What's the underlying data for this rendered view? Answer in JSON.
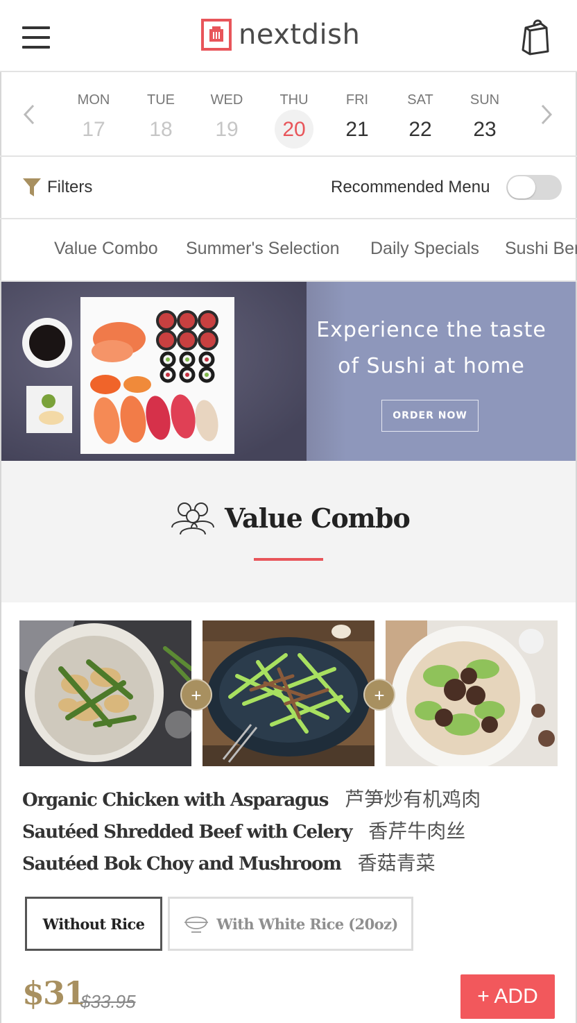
{
  "header": {
    "brand": "nextdish",
    "icons": {
      "menu": "hamburger-menu-icon",
      "logo": "nextdish-logo-icon",
      "cart": "shopping-bag-icon"
    }
  },
  "dates": {
    "days": [
      {
        "name": "MON",
        "num": "17",
        "state": "past"
      },
      {
        "name": "TUE",
        "num": "18",
        "state": "past"
      },
      {
        "name": "WED",
        "num": "19",
        "state": "past"
      },
      {
        "name": "THU",
        "num": "20",
        "state": "today"
      },
      {
        "name": "FRI",
        "num": "21",
        "state": "future"
      },
      {
        "name": "SAT",
        "num": "22",
        "state": "future"
      },
      {
        "name": "SUN",
        "num": "23",
        "state": "future"
      }
    ]
  },
  "filters": {
    "label": "Filters",
    "recommended_label": "Recommended Menu",
    "recommended_on": false
  },
  "tabs": [
    "Value Combo",
    "Summer's Selection",
    "Daily Specials",
    "Sushi Bento"
  ],
  "banner": {
    "line1": "Experience the taste",
    "line2": "of Sushi at home",
    "cta": "ORDER NOW"
  },
  "section": {
    "title": "Value Combo"
  },
  "combo": {
    "dishes": [
      {
        "en": "Organic Chicken with Asparagus",
        "cn": "芦笋炒有机鸡肉"
      },
      {
        "en": "Sautéed Shredded Beef with Celery",
        "cn": "香芹牛肉丝"
      },
      {
        "en": "Sautéed Bok Choy and Mushroom",
        "cn": "香菇青菜"
      }
    ],
    "options": {
      "without_rice": "Without Rice",
      "with_rice": "With White Rice (20oz)"
    },
    "price": "$31",
    "old_price": "$33.95",
    "add_label": "+ ADD"
  },
  "colors": {
    "accent": "#e8555a",
    "gold": "#a89060",
    "banner_bg": "#8e97bb",
    "add_button": "#f2585c"
  }
}
